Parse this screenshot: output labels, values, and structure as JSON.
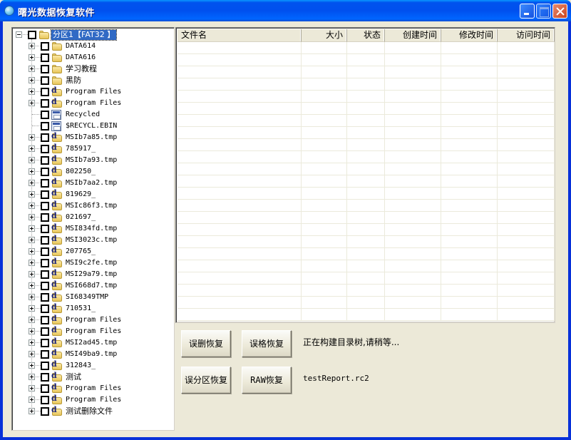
{
  "window": {
    "title": "曙光数据恢复软件",
    "icon": "app-orb-icon",
    "controls": {
      "minimize": "minimize-icon",
      "maximize": "maximize-icon",
      "close": "close-icon"
    }
  },
  "tree": {
    "root": {
      "label": "分区1【FAT32 】",
      "expanded": true,
      "checked": false,
      "selected": true,
      "icon": "folder-icon"
    },
    "children": [
      {
        "label": "DATA614",
        "icon": "folder-icon",
        "expandable": true,
        "checked": false
      },
      {
        "label": "DATA616",
        "icon": "folder-icon",
        "expandable": true,
        "checked": false
      },
      {
        "label": "学习教程",
        "icon": "folder-icon",
        "expandable": true,
        "checked": false
      },
      {
        "label": "黑防",
        "icon": "folder-icon",
        "expandable": true,
        "checked": false
      },
      {
        "label": "Program Files",
        "icon": "deleted-folder-icon",
        "expandable": true,
        "checked": false
      },
      {
        "label": "Program Files",
        "icon": "deleted-folder-icon",
        "expandable": true,
        "checked": false
      },
      {
        "label": "Recycled",
        "icon": "recycle-bin-icon",
        "expandable": false,
        "checked": false
      },
      {
        "label": "$RECYCL.EBIN",
        "icon": "recycle-bin-icon",
        "expandable": false,
        "checked": false
      },
      {
        "label": "MSIb7a85.tmp",
        "icon": "deleted-folder-icon",
        "expandable": true,
        "checked": false
      },
      {
        "label": "785917_",
        "icon": "deleted-folder-icon",
        "expandable": true,
        "checked": false
      },
      {
        "label": "MSIb7a93.tmp",
        "icon": "deleted-folder-icon",
        "expandable": true,
        "checked": false
      },
      {
        "label": "802250_",
        "icon": "deleted-folder-icon",
        "expandable": true,
        "checked": false
      },
      {
        "label": "MSIb7aa2.tmp",
        "icon": "deleted-folder-icon",
        "expandable": true,
        "checked": false
      },
      {
        "label": "819629_",
        "icon": "deleted-folder-icon",
        "expandable": true,
        "checked": false
      },
      {
        "label": "MSIc86f3.tmp",
        "icon": "deleted-folder-icon",
        "expandable": true,
        "checked": false
      },
      {
        "label": "021697_",
        "icon": "deleted-folder-icon",
        "expandable": true,
        "checked": false
      },
      {
        "label": "MSI834fd.tmp",
        "icon": "deleted-folder-icon",
        "expandable": true,
        "checked": false
      },
      {
        "label": "MSI3023c.tmp",
        "icon": "deleted-folder-icon",
        "expandable": true,
        "checked": false
      },
      {
        "label": "207765_",
        "icon": "deleted-folder-icon",
        "expandable": true,
        "checked": false
      },
      {
        "label": "MSI9c2fe.tmp",
        "icon": "deleted-folder-icon",
        "expandable": true,
        "checked": false
      },
      {
        "label": "MSI29a79.tmp",
        "icon": "deleted-folder-icon",
        "expandable": true,
        "checked": false
      },
      {
        "label": "MSI668d7.tmp",
        "icon": "deleted-folder-icon",
        "expandable": true,
        "checked": false
      },
      {
        "label": "SI68349TMP",
        "icon": "deleted-folder-icon",
        "expandable": true,
        "checked": false
      },
      {
        "label": "710531_",
        "icon": "deleted-folder-icon",
        "expandable": true,
        "checked": false
      },
      {
        "label": "Program Files",
        "icon": "deleted-folder-icon",
        "expandable": true,
        "checked": false
      },
      {
        "label": "Program Files",
        "icon": "deleted-folder-icon",
        "expandable": true,
        "checked": false
      },
      {
        "label": "MSI2ad45.tmp",
        "icon": "deleted-folder-icon",
        "expandable": true,
        "checked": false
      },
      {
        "label": "MSI49ba9.tmp",
        "icon": "deleted-folder-icon",
        "expandable": true,
        "checked": false
      },
      {
        "label": "312843_",
        "icon": "deleted-folder-icon",
        "expandable": true,
        "checked": false
      },
      {
        "label": "测试",
        "icon": "deleted-folder-icon",
        "expandable": true,
        "checked": false
      },
      {
        "label": "Program Files",
        "icon": "deleted-folder-icon",
        "expandable": true,
        "checked": false
      },
      {
        "label": "Program Files",
        "icon": "deleted-folder-icon",
        "expandable": true,
        "checked": false
      },
      {
        "label": "测试删除文件",
        "icon": "deleted-folder-icon",
        "expandable": true,
        "checked": false
      }
    ]
  },
  "file_list": {
    "columns": [
      {
        "label": "文件名",
        "align": "left"
      },
      {
        "label": "大小",
        "align": "right"
      },
      {
        "label": "状态",
        "align": "right"
      },
      {
        "label": "创建时间",
        "align": "right"
      },
      {
        "label": "修改时间",
        "align": "right"
      },
      {
        "label": "访问时间",
        "align": "right"
      }
    ],
    "rows": []
  },
  "actions": {
    "undelete": "误删恢复",
    "unformat": "误格恢复",
    "partition_recovery": "误分区恢复",
    "raw_recovery": "RAW恢复"
  },
  "status": {
    "progress_message": "正在构建目录树,请稍等...",
    "report_file": "testReport.rc2"
  }
}
